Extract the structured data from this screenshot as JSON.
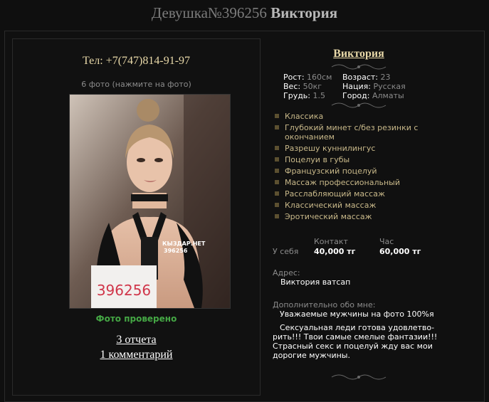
{
  "page": {
    "title_prefix": "Девушка№396256",
    "title_name": "Виктория"
  },
  "left": {
    "phone": "Тел: +7(747)814-91-97",
    "photo_hint": "6 фото (нажмите на фото)",
    "photo_watermark_line1": "КЫЗДАР.НЕТ",
    "photo_watermark_line2": "396256",
    "photo_sign": "396256",
    "verified": "Фото проверено",
    "reports": "3 отчета",
    "comments": "1 комментарий"
  },
  "profile": {
    "name": "Виктория",
    "params": [
      {
        "label": "Рост:",
        "value": "160см"
      },
      {
        "label": "Вес:",
        "value": "50кг"
      },
      {
        "label": "Грудь:",
        "value": "1.5"
      },
      {
        "label": "Возраст:",
        "value": "23"
      },
      {
        "label": "Нация:",
        "value": "Русская"
      },
      {
        "label": "Город:",
        "value": "Алматы"
      }
    ],
    "services": [
      "Классика",
      "Глубокий минет с/без резинки с окончанием",
      "Разрешу куннилингус",
      "Поцелуи в губы",
      "Французский поцелуй",
      "Массаж профессиональный",
      "Расслабляющий массаж",
      "Классический массаж",
      "Эротический массаж"
    ],
    "prices": {
      "col1": "Контакт",
      "col2": "Час",
      "row_label": "У себя",
      "v1": "40,000 тг",
      "v2": "60,000 тг"
    },
    "address_label": "Адрес:",
    "address_value": "Виктория ватсап",
    "about_label": "Дополнительно обо мне:",
    "about_title": "Уважаемые мужчины на фото 100%я",
    "about_text": "Сексуальная леди готова удовлетво-рить!!! Твои самые смелые фантазии!!! Страсный секс и поцелуй жду вас мои дорогие мужчины."
  },
  "colors": {
    "accent": "#e8d8a8",
    "verified": "#45a845",
    "bg": "#0f0f0f"
  }
}
